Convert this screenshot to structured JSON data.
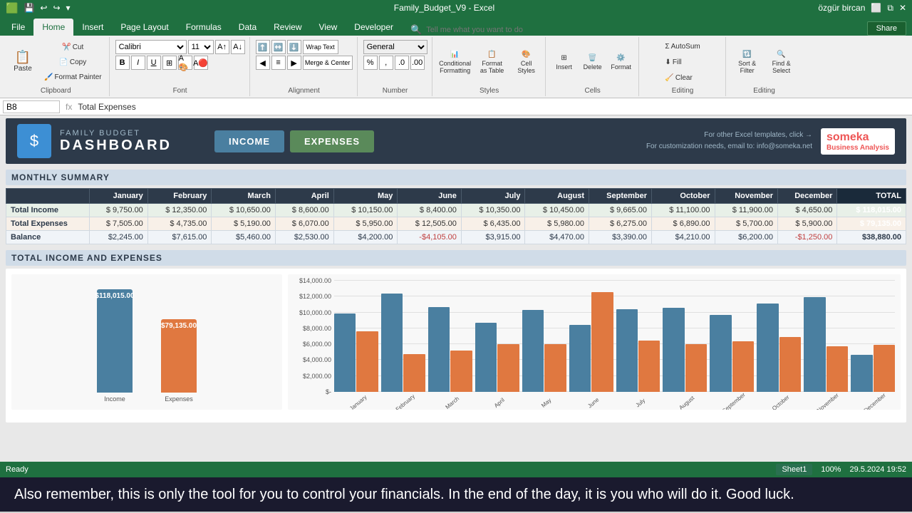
{
  "titlebar": {
    "title": "Family_Budget_V9 - Excel",
    "user": "özgür bircan",
    "save_icon": "💾",
    "undo_icon": "↩",
    "redo_icon": "↪"
  },
  "tabs": [
    {
      "label": "File",
      "active": false
    },
    {
      "label": "Home",
      "active": true
    },
    {
      "label": "Insert",
      "active": false
    },
    {
      "label": "Page Layout",
      "active": false
    },
    {
      "label": "Formulas",
      "active": false
    },
    {
      "label": "Data",
      "active": false
    },
    {
      "label": "Review",
      "active": false
    },
    {
      "label": "View",
      "active": false
    },
    {
      "label": "Developer",
      "active": false
    }
  ],
  "ribbon": {
    "clipboard": {
      "label": "Clipboard",
      "paste": "Paste",
      "cut": "Cut",
      "copy": "Copy",
      "format_painter": "Format Painter"
    },
    "font": {
      "label": "Font",
      "family": "Calibri",
      "size": "11"
    },
    "alignment": {
      "label": "Alignment",
      "wrap_text": "Wrap Text",
      "merge": "Merge & Center"
    },
    "number": {
      "label": "Number",
      "format": "General"
    },
    "styles": {
      "label": "Styles",
      "conditional": "Conditional Formatting",
      "format_as_table": "Format as Table",
      "cell_styles": "Cell Styles"
    },
    "cells": {
      "label": "Cells",
      "insert": "Insert",
      "delete": "Delete",
      "format": "Format"
    },
    "editing": {
      "label": "Editing",
      "autosum": "AutoSum",
      "fill": "Fill",
      "clear": "Clear",
      "sort_filter": "Sort & Filter",
      "find_select": "Find & Select"
    }
  },
  "formula_bar": {
    "cell_ref": "B8",
    "formula": "Total Expenses"
  },
  "tell_me": "Tell me what you want to do",
  "share_btn": "Share",
  "dashboard": {
    "logo_icon": "$",
    "title_main": "FAMILY BUDGET",
    "title_sub": "DASHBOARD",
    "income_btn": "INCOME",
    "expenses_btn": "EXPENSES",
    "header_info_1": "For other Excel templates, click →",
    "header_info_2": "For customization needs, email to: info@someka.net",
    "someka_label": "someka",
    "someka_sub": "Business Analysis",
    "monthly_summary_title": "MONTHLY SUMMARY",
    "total_income_and_expenses_title": "TOTAL INCOME AND EXPENSES",
    "table": {
      "headers": [
        "",
        "January",
        "February",
        "March",
        "April",
        "May",
        "June",
        "July",
        "August",
        "September",
        "October",
        "November",
        "December",
        "TOTAL"
      ],
      "rows": [
        {
          "label": "Total Income",
          "values": [
            "$ 9,750.00",
            "$ 12,350.00",
            "$ 10,650.00",
            "$ 8,600.00",
            "$ 10,150.00",
            "$ 8,400.00",
            "$ 10,350.00",
            "$ 10,450.00",
            "$ 9,665.00",
            "$ 11,100.00",
            "$ 11,900.00",
            "$ 4,650.00",
            "$ 118,015.00"
          ],
          "type": "income"
        },
        {
          "label": "Total Expenses",
          "values": [
            "$ 7,505.00",
            "$ 4,735.00",
            "$ 5,190.00",
            "$ 6,070.00",
            "$ 5,950.00",
            "$ 12,505.00",
            "$ 6,435.00",
            "$ 5,980.00",
            "$ 6,275.00",
            "$ 6,890.00",
            "$ 5,700.00",
            "$ 5,900.00",
            "$ 79,135.00"
          ],
          "type": "expense"
        },
        {
          "label": "Balance",
          "values": [
            "$2,245.00",
            "$7,615.00",
            "$5,460.00",
            "$2,530.00",
            "$4,200.00",
            "-$4,105.00",
            "$3,915.00",
            "$4,470.00",
            "$3,390.00",
            "$4,210.00",
            "$6,200.00",
            "-$1,250.00",
            "$38,880.00"
          ],
          "type": "balance",
          "negatives": [
            5,
            11
          ]
        }
      ]
    },
    "bar_chart": {
      "income_label": "$118,015.00",
      "expense_label": "$79,135.00"
    },
    "monthly_bars": [
      {
        "month": "January",
        "income_pct": 70,
        "expense_pct": 54
      },
      {
        "month": "February",
        "income_pct": 88,
        "expense_pct": 34
      },
      {
        "month": "March",
        "income_pct": 76,
        "expense_pct": 37
      },
      {
        "month": "April",
        "income_pct": 62,
        "expense_pct": 43
      },
      {
        "month": "May",
        "income_pct": 73,
        "expense_pct": 43
      },
      {
        "month": "June",
        "income_pct": 60,
        "expense_pct": 89
      },
      {
        "month": "July",
        "income_pct": 74,
        "expense_pct": 46
      },
      {
        "month": "August",
        "income_pct": 75,
        "expense_pct": 43
      },
      {
        "month": "September",
        "income_pct": 69,
        "expense_pct": 45
      },
      {
        "month": "October",
        "income_pct": 79,
        "expense_pct": 49
      },
      {
        "month": "November",
        "income_pct": 85,
        "expense_pct": 41
      },
      {
        "month": "December",
        "income_pct": 33,
        "expense_pct": 42
      }
    ],
    "chart_y_labels": [
      "$14,000.00",
      "$12,000.00",
      "$10,000.00",
      "$8,000.00",
      "$6,000.00",
      "$4,000.00",
      "$2,000.00",
      "$-"
    ]
  },
  "status_bar": {
    "sheet_name": "Sheet1",
    "status": "Ready",
    "zoom": "100%",
    "time": "29.5.2024   19:52"
  },
  "bottom_banner": {
    "text": "Also remember, this is only the tool for you to control your financials. In the end of the day, it is you who will do it. Good luck."
  }
}
